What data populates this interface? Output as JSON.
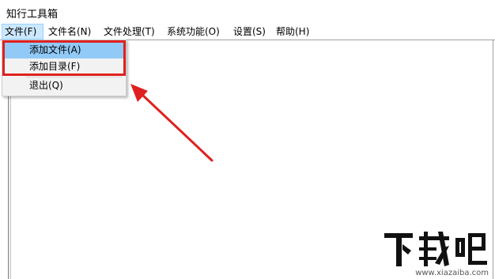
{
  "window": {
    "title": "知行工具箱"
  },
  "menubar": {
    "items": [
      {
        "label": "文件(F)"
      },
      {
        "label": "文件名(N)"
      },
      {
        "label": "文件处理(T)"
      },
      {
        "label": "系统功能(O)"
      },
      {
        "label": "设置(S)"
      },
      {
        "label": "帮助(H)"
      }
    ],
    "active_index": 0
  },
  "file_menu": {
    "items": [
      {
        "label": "添加文件(A)"
      },
      {
        "label": "添加目录(F)"
      },
      {
        "label": "退出(Q)"
      }
    ],
    "highlighted_index": 0
  },
  "annotation": {
    "color": "#e02020"
  },
  "watermark": {
    "logo_text": "下载吧",
    "url": "www.xiazaiba.com"
  },
  "colors": {
    "menu_active_bg": "#cce8ff",
    "dropdown_hover_bg": "#91c9f7",
    "dropdown_bg": "#f2f2f2"
  }
}
